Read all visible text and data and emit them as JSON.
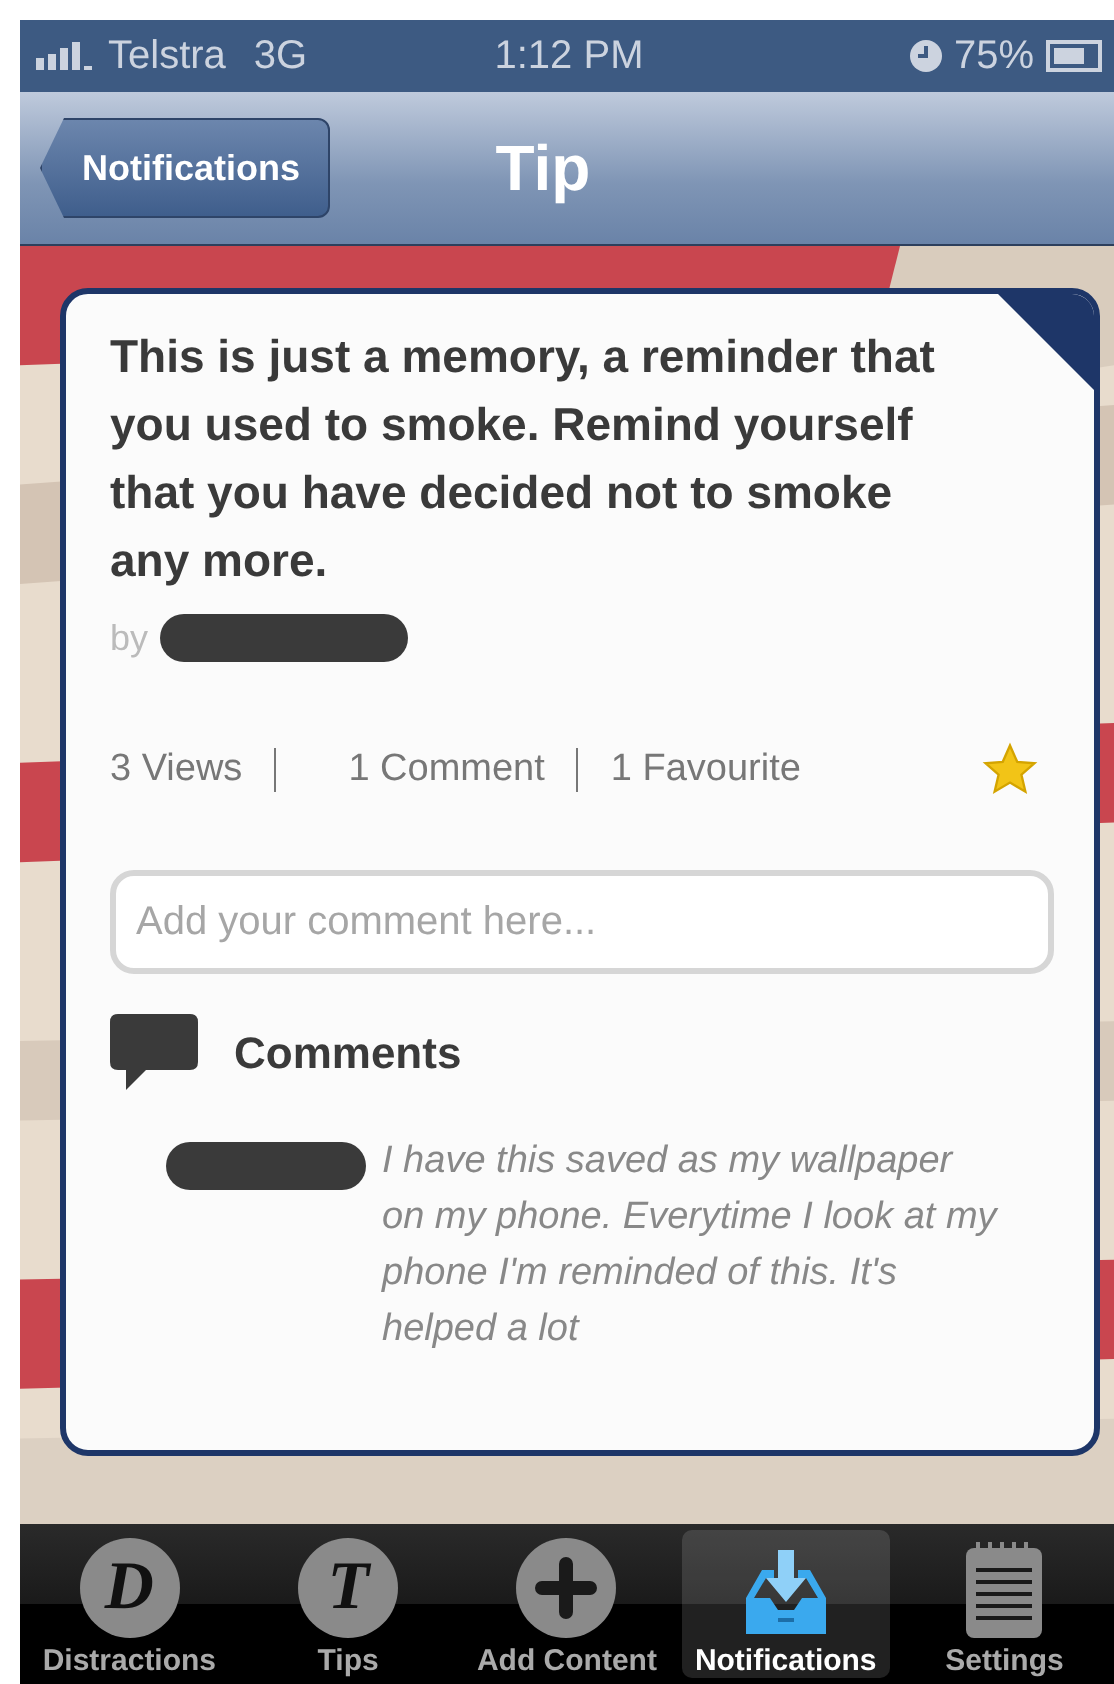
{
  "status_bar": {
    "carrier": "Telstra",
    "network": "3G",
    "time": "1:12 PM",
    "battery": "75%"
  },
  "nav_bar": {
    "back": "Notifications",
    "title": "Tip"
  },
  "tip": {
    "text": "This is just a memory, a reminder that you used to smoke. Remind yourself that you have decided not to smoke any more.",
    "by": "by",
    "views": "3 Views",
    "comments": "1 Comment",
    "favourites": "1 Favourite",
    "favourited": true
  },
  "comment_field": {
    "placeholder": "Add your comment here..."
  },
  "comments_heading": "Comments",
  "comments": [
    {
      "text": "I have this saved as my wallpaper on my phone. Everytime I look at my phone I'm reminded of this. It's helped a lot"
    }
  ],
  "tabs": [
    {
      "label": "Distractions",
      "kind": "letter",
      "glyph": "D",
      "selected": false
    },
    {
      "label": "Tips",
      "kind": "letter",
      "glyph": "T",
      "selected": false
    },
    {
      "label": "Add Content",
      "kind": "plus",
      "selected": false
    },
    {
      "label": "Notifications",
      "kind": "inbox",
      "selected": true
    },
    {
      "label": "Settings",
      "kind": "notepad",
      "selected": false
    }
  ]
}
